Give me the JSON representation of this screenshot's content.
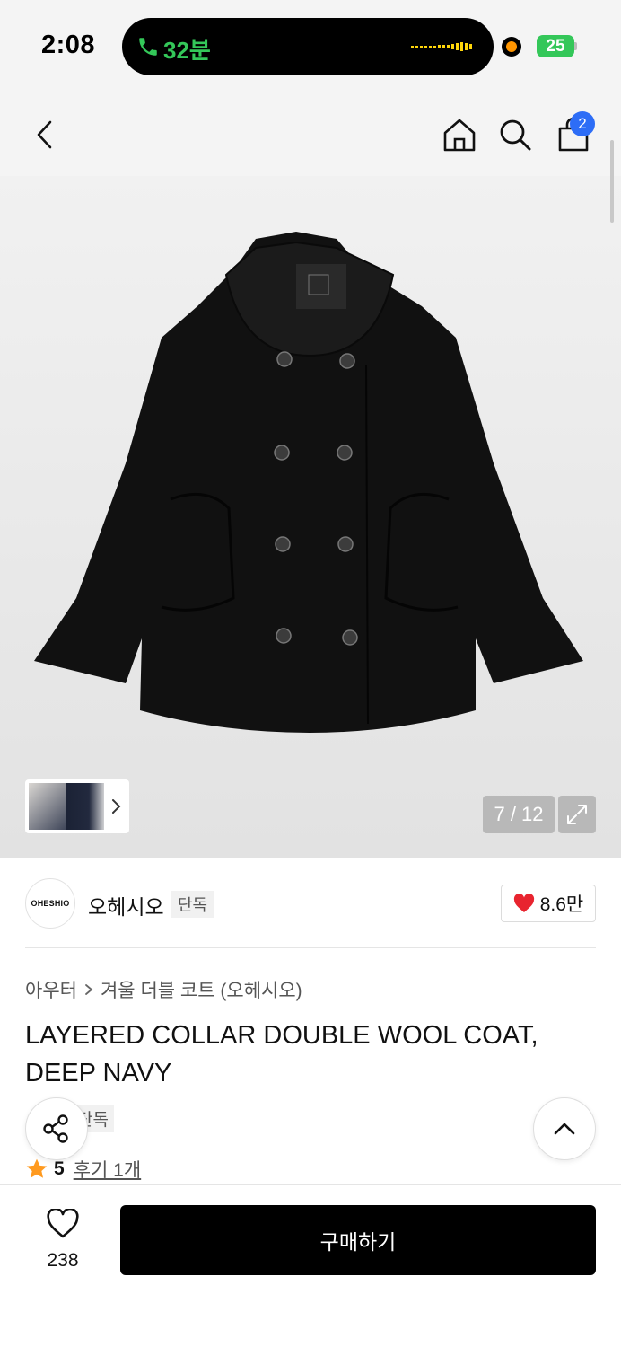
{
  "status_bar": {
    "time": "2:08",
    "call_duration": "32분",
    "battery": "25"
  },
  "nav": {
    "cart_badge": "2",
    "icons": [
      "back-icon",
      "home-icon",
      "search-icon",
      "cart-icon"
    ]
  },
  "gallery": {
    "counter": "7 / 12",
    "current_image": 7,
    "total_images": 12
  },
  "brand": {
    "logo_text": "OHESHIO",
    "name": "오헤시오",
    "badge": "단독",
    "likes": "8.6만"
  },
  "product": {
    "category": "아우터",
    "subcategory": "겨울 더블 코트 (오헤시오)",
    "title": "LAYERED COLLAR DOUBLE WOOL COAT, DEEP NAVY",
    "tag": "단독",
    "rating": "5",
    "reviews": "후기 1개"
  },
  "bottom": {
    "wish_count": "238",
    "buy_label": "구매하기"
  },
  "colors": {
    "accent_badge": "#2d6df6",
    "heart": "#e8242f",
    "star": "#ff9a1f",
    "call_green": "#34c759",
    "buy_button": "#000000"
  }
}
